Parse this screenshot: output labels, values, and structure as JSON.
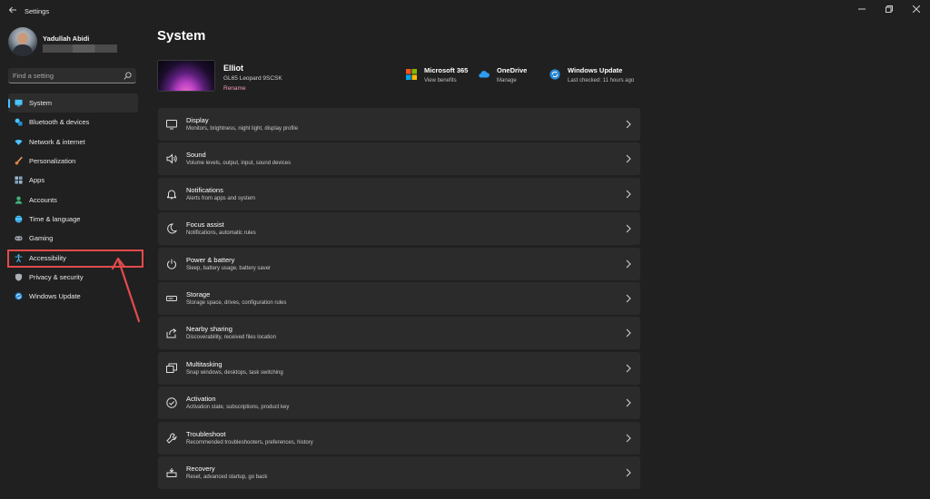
{
  "window": {
    "title": "Settings"
  },
  "user": {
    "name": "Yadullah Abidi"
  },
  "search": {
    "placeholder": "Find a setting"
  },
  "sidebar": {
    "items": [
      {
        "label": "System",
        "icon": "system-icon",
        "selected": true
      },
      {
        "label": "Bluetooth & devices",
        "icon": "bluetooth-icon"
      },
      {
        "label": "Network & internet",
        "icon": "wifi-icon"
      },
      {
        "label": "Personalization",
        "icon": "brush-icon"
      },
      {
        "label": "Apps",
        "icon": "apps-icon"
      },
      {
        "label": "Accounts",
        "icon": "accounts-icon"
      },
      {
        "label": "Time & language",
        "icon": "globe-icon"
      },
      {
        "label": "Gaming",
        "icon": "gamepad-icon"
      },
      {
        "label": "Accessibility",
        "icon": "accessibility-icon",
        "highlighted": true
      },
      {
        "label": "Privacy & security",
        "icon": "shield-icon"
      },
      {
        "label": "Windows Update",
        "icon": "update-icon"
      }
    ]
  },
  "main": {
    "title": "System",
    "device": {
      "name": "Elliot",
      "model": "GL65 Leopard 9SCSK",
      "rename_label": "Rename"
    },
    "quick_links": [
      {
        "title": "Microsoft 365",
        "subtitle": "View benefits",
        "icon": "microsoft-icon"
      },
      {
        "title": "OneDrive",
        "subtitle": "Manage",
        "icon": "onedrive-icon"
      },
      {
        "title": "Windows Update",
        "subtitle": "Last checked: 11 hours ago",
        "icon": "sync-icon"
      }
    ],
    "cards": [
      {
        "title": "Display",
        "subtitle": "Monitors, brightness, night light, display profile",
        "icon": "display-icon"
      },
      {
        "title": "Sound",
        "subtitle": "Volume levels, output, input, sound devices",
        "icon": "speaker-icon"
      },
      {
        "title": "Notifications",
        "subtitle": "Alerts from apps and system",
        "icon": "bell-icon"
      },
      {
        "title": "Focus assist",
        "subtitle": "Notifications, automatic rules",
        "icon": "moon-icon"
      },
      {
        "title": "Power & battery",
        "subtitle": "Sleep, battery usage, battery saver",
        "icon": "power-icon"
      },
      {
        "title": "Storage",
        "subtitle": "Storage space, drives, configuration rules",
        "icon": "storage-icon"
      },
      {
        "title": "Nearby sharing",
        "subtitle": "Discoverability, received files location",
        "icon": "share-icon"
      },
      {
        "title": "Multitasking",
        "subtitle": "Snap windows, desktops, task switching",
        "icon": "multitask-icon"
      },
      {
        "title": "Activation",
        "subtitle": "Activation state, subscriptions, product key",
        "icon": "check-circle-icon"
      },
      {
        "title": "Troubleshoot",
        "subtitle": "Recommended troubleshooters, preferences, history",
        "icon": "wrench-icon"
      },
      {
        "title": "Recovery",
        "subtitle": "Reset, advanced startup, go back",
        "icon": "recovery-icon"
      }
    ]
  },
  "colors": {
    "accent": "#4cc2ff",
    "background": "#202020",
    "card": "#2b2b2b",
    "highlight": "#e24b4b",
    "rename_link": "#f39ab5"
  }
}
